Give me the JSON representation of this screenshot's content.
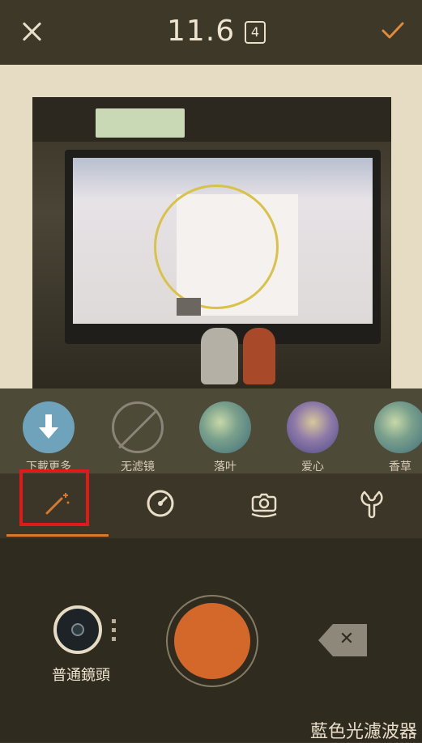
{
  "header": {
    "close_icon": "close-icon",
    "version": "11.6",
    "badge": "4",
    "confirm_icon": "check-icon",
    "accent": "#e08a3a"
  },
  "filters": [
    {
      "label": "下載更多",
      "icon": "download-icon"
    },
    {
      "label": "无滤镜",
      "icon": "no-filter-icon"
    },
    {
      "label": "落叶",
      "icon": "filter-thumbnail"
    },
    {
      "label": "爱心",
      "icon": "filter-thumbnail"
    },
    {
      "label": "香草",
      "icon": "filter-thumbnail"
    }
  ],
  "toolbar": {
    "tabs": [
      {
        "icon": "magic-wand-icon",
        "selected": true
      },
      {
        "icon": "timer-icon"
      },
      {
        "icon": "camera-switch-icon"
      },
      {
        "icon": "wrench-icon"
      }
    ],
    "active_color": "#d7792f",
    "highlight_color": "#e01a1a"
  },
  "bottom": {
    "lens_label": "普通鏡頭",
    "shutter_color": "#d4672a",
    "delete_icon": "backspace-icon"
  },
  "watermark": "藍色光濾波器"
}
